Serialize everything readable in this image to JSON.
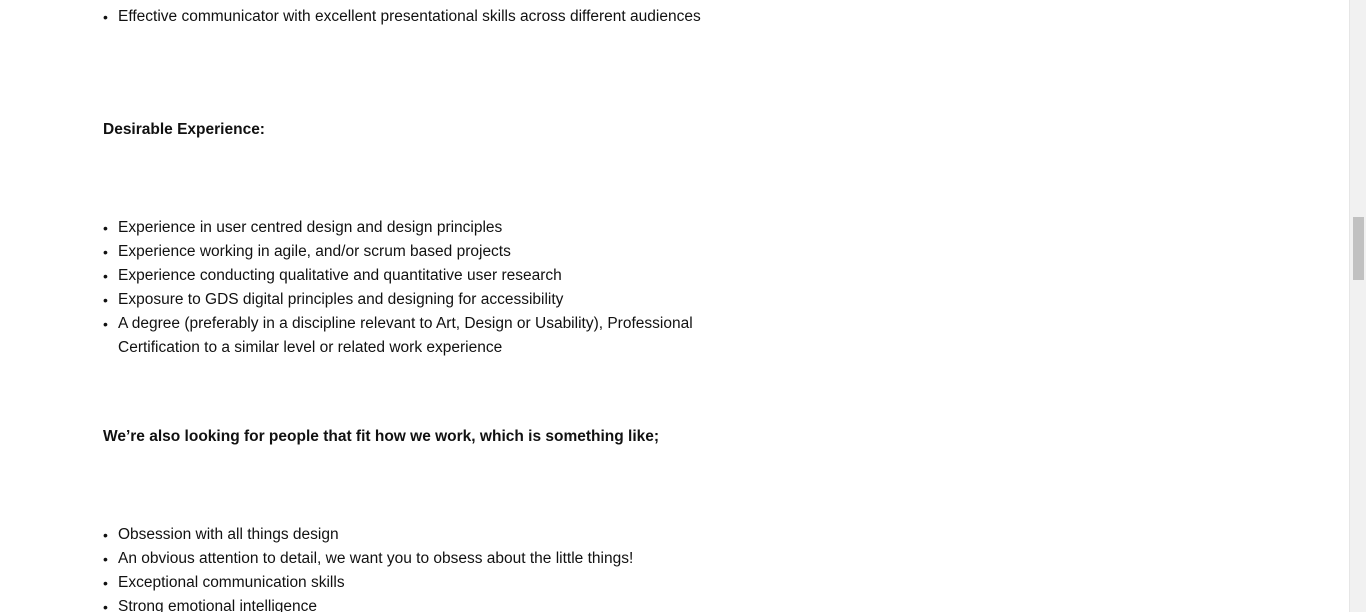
{
  "list_1": {
    "items": [
      "Effective communicator with excellent presentational skills across different audiences"
    ]
  },
  "desirable": {
    "heading": "Desirable Experience:",
    "items": [
      "Experience in user centred design and design principles",
      "Experience working in agile, and/or scrum based projects",
      "Experience conducting qualitative and quantitative user research",
      "Exposure to GDS digital principles and designing for accessibility",
      "A degree (preferably in a discipline relevant to Art, Design or Usability), Professional Certification to a similar level or related work experience"
    ]
  },
  "looking_for": {
    "heading": "We’re also looking for people that fit how we work, which is something like;",
    "items": [
      "Obsession with all things design",
      "An obvious attention to detail, we want you to obsess about the little things!",
      "Exceptional communication skills",
      "Strong emotional intelligence"
    ]
  },
  "bullet_glyph": "•"
}
